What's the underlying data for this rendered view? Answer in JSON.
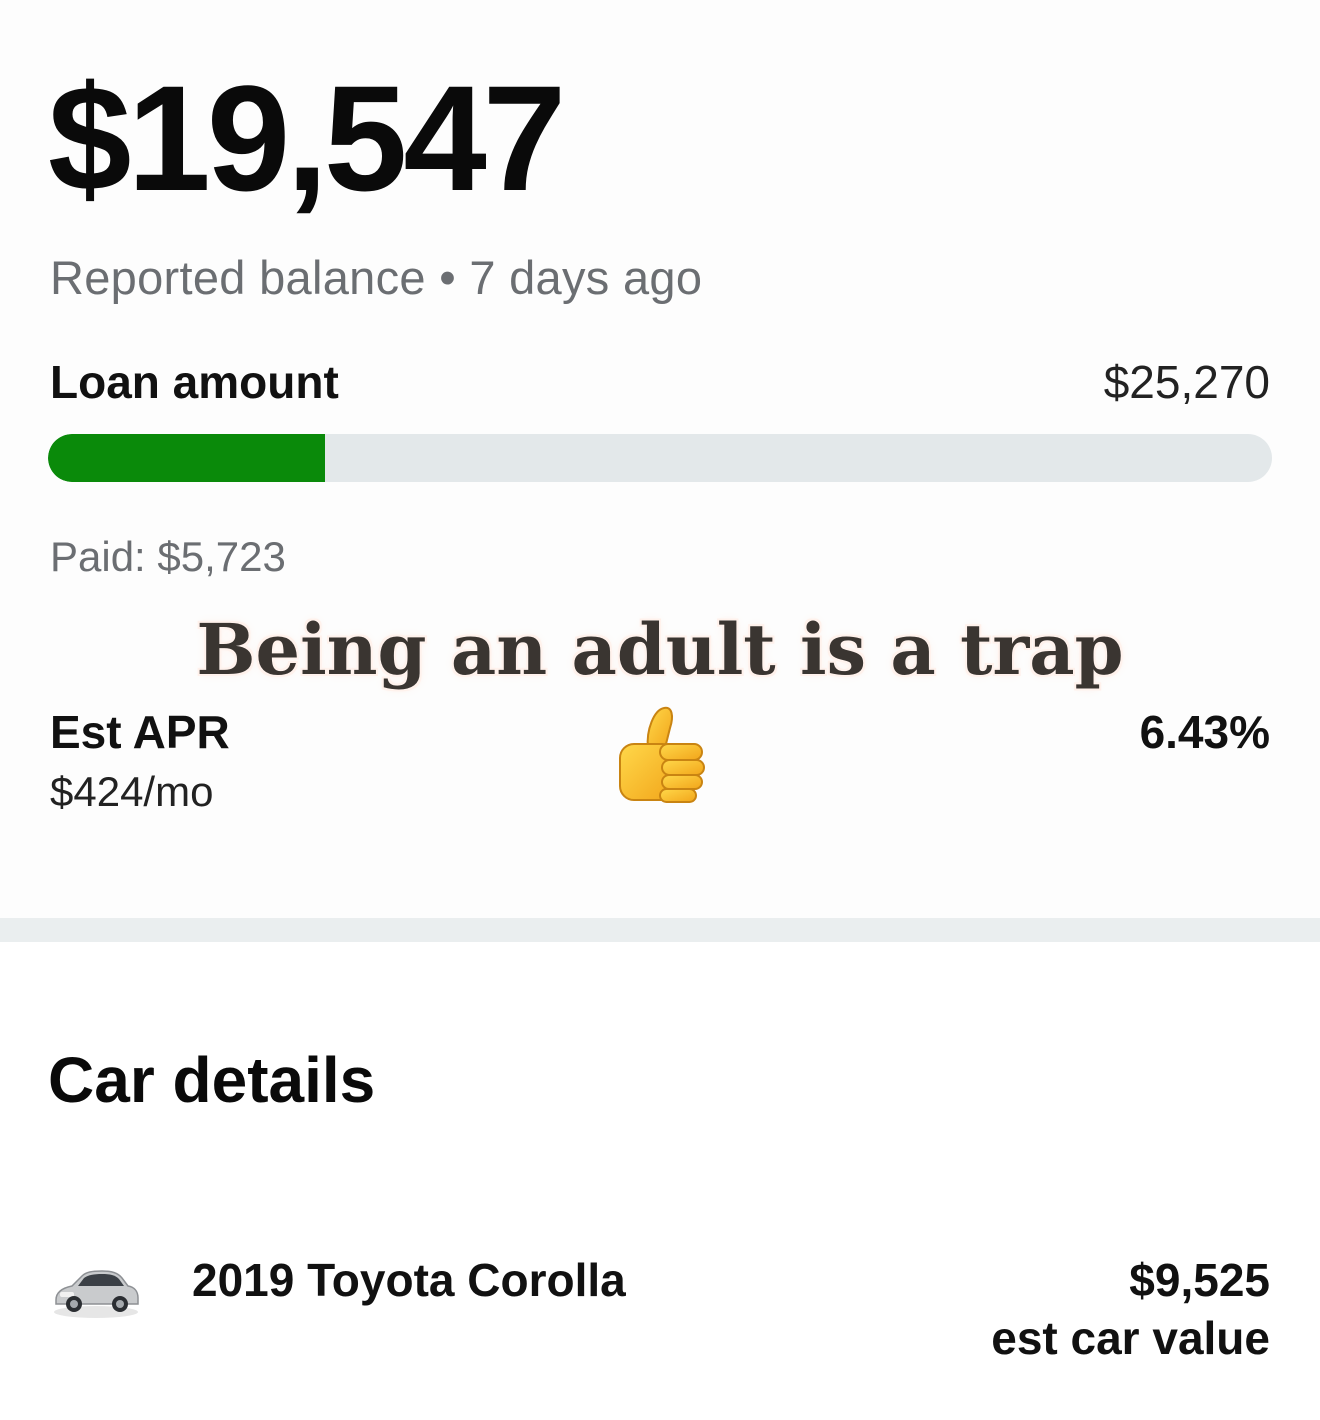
{
  "loan": {
    "balance": "$19,547",
    "balance_subtitle": "Reported balance • 7 days ago",
    "amount_label": "Loan amount",
    "amount_value": "$25,270",
    "paid_text": "Paid: $5,723",
    "paid_fraction": 0.2265,
    "progress_color": "#0a8a0a",
    "apr_label": "Est APR",
    "apr_value": "6.43%",
    "monthly_payment": "$424/mo"
  },
  "overlay": {
    "caption": "Being an adult is a trap",
    "emoji_icon": "thumbs-up-icon"
  },
  "car_details": {
    "title": "Car details",
    "car_icon": "car-thumbnail",
    "car_name": "2019 Toyota Corolla",
    "car_value": "$9,525",
    "car_value_label": "est car value"
  }
}
